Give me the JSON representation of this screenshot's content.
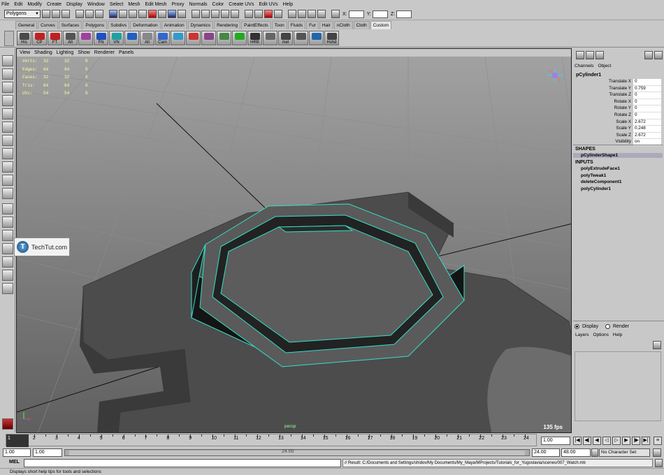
{
  "menubar": [
    "File",
    "Edit",
    "Modify",
    "Create",
    "Display",
    "Window",
    "Select",
    "Mesh",
    "Edit Mesh",
    "Proxy",
    "Normals",
    "Color",
    "Create UVs",
    "Edit UVs",
    "Help"
  ],
  "status": {
    "mode": "Polygons",
    "x_label": "X:",
    "y_label": "Y:",
    "z_label": "Z:"
  },
  "shelf_tabs": [
    "General",
    "Curves",
    "Surfaces",
    "Polygons",
    "Subdivs",
    "Deformation",
    "Animation",
    "Dynamics",
    "Rendering",
    "PaintEffects",
    "Toon",
    "Fluids",
    "Fur",
    "Hair",
    "nCloth",
    "Cloth",
    "Custom"
  ],
  "shelf_active": "Custom",
  "shelf_buttons": [
    {
      "label": "His",
      "color": "#4a4a4a"
    },
    {
      "label": "CP",
      "color": "#c02020"
    },
    {
      "label": "FT",
      "color": "#c02020"
    },
    {
      "label": "All",
      "color": "#555"
    },
    {
      "label": "",
      "color": "#a040a0"
    },
    {
      "label": "FN",
      "color": "#2050c0"
    },
    {
      "label": "VN",
      "color": "#20a0a0"
    },
    {
      "label": "",
      "color": "#2060c0"
    },
    {
      "label": "All",
      "color": "#888"
    },
    {
      "label": "Cam",
      "color": "#3366cc"
    },
    {
      "label": "",
      "color": "#3399cc"
    },
    {
      "label": "",
      "color": "#cc3333"
    },
    {
      "label": "",
      "color": "#884488"
    },
    {
      "label": "",
      "color": "#448844"
    },
    {
      "label": "",
      "color": "#22aa22"
    },
    {
      "label": "HRB",
      "color": "#333"
    },
    {
      "label": "",
      "color": "#666"
    },
    {
      "label": "mel",
      "color": "#444"
    },
    {
      "label": "",
      "color": "#555"
    },
    {
      "label": "",
      "color": "#2266aa"
    },
    {
      "label": "Hshd",
      "color": "#444"
    }
  ],
  "panel_menu": [
    "View",
    "Shading",
    "Lighting",
    "Show",
    "Renderer",
    "Panels"
  ],
  "hud": [
    {
      "k": "Verts:",
      "a": "32",
      "b": "32",
      "c": "0"
    },
    {
      "k": "Edges:",
      "a": "64",
      "b": "64",
      "c": "0"
    },
    {
      "k": "Faces:",
      "a": "32",
      "b": "32",
      "c": "0"
    },
    {
      "k": "Tris:",
      "a": "64",
      "b": "64",
      "c": "0"
    },
    {
      "k": "UVs:",
      "a": "54",
      "b": "54",
      "c": "0"
    }
  ],
  "viewport": {
    "camera": "persp",
    "fps": "135 fps"
  },
  "watermark": {
    "logo_letter": "T",
    "text": "TechTut.com"
  },
  "channel_box": {
    "tabs": [
      "Channels",
      "Object"
    ],
    "object": "pCylinder1",
    "attributes": [
      {
        "name": "Translate X",
        "value": "0"
      },
      {
        "name": "Translate Y",
        "value": "0.759"
      },
      {
        "name": "Translate Z",
        "value": "0"
      },
      {
        "name": "Rotate X",
        "value": "0"
      },
      {
        "name": "Rotate Y",
        "value": "0"
      },
      {
        "name": "Rotate Z",
        "value": "0"
      },
      {
        "name": "Scale X",
        "value": "2.672"
      },
      {
        "name": "Scale Y",
        "value": "0.248"
      },
      {
        "name": "Scale Z",
        "value": "2.672"
      },
      {
        "name": "Visibility",
        "value": "on"
      }
    ],
    "shapes_label": "SHAPES",
    "shape": "pCylinderShape1",
    "inputs_label": "INPUTS",
    "inputs": [
      "polyExtrudeFace1",
      "polyTweak1",
      "deleteComponent1",
      "polyCylinder1"
    ]
  },
  "layer_editor": {
    "display": "Display",
    "render": "Render",
    "menu": [
      "Layers",
      "Options",
      "Help"
    ]
  },
  "timeline": {
    "current": "1",
    "ticks": [
      "1",
      "2",
      "3",
      "4",
      "5",
      "6",
      "7",
      "8",
      "9",
      "10",
      "11",
      "12",
      "13",
      "14",
      "15",
      "16",
      "17",
      "18",
      "19",
      "20",
      "21",
      "22",
      "23",
      "24"
    ],
    "current_field": "1.00"
  },
  "range": {
    "start": "1.00",
    "anim_start": "1.00",
    "bar_label": "24.00",
    "end": "24.00",
    "anim_end": "48.00",
    "char_set": "No Character Set"
  },
  "cmd": {
    "mel": "MEL",
    "result": "// Result: C:/Documents and Settings/shidov/My Documents/My_Maya/MProjects/Tutorials_for_Yugoslavia/scenes/007_Watch.mb"
  },
  "help_line": "Displays short help tips for tools and selections"
}
